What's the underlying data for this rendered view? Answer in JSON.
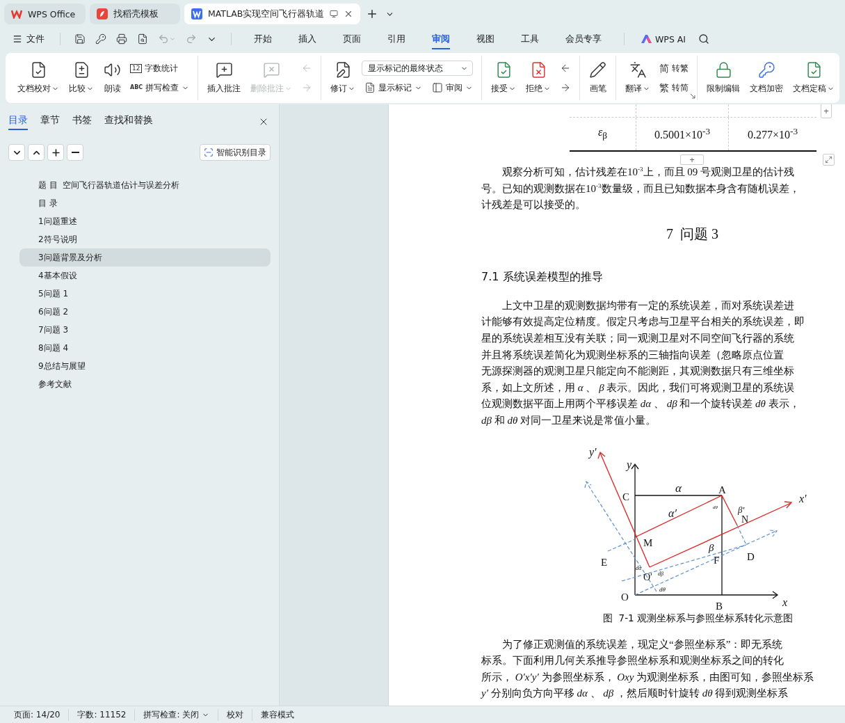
{
  "app_tabs": [
    {
      "kind": "home",
      "label": "WPS Office",
      "selected": false
    },
    {
      "kind": "template",
      "label": "找稻壳模板",
      "selected": false
    },
    {
      "kind": "doc",
      "label": "MATLAB实现空间飞行器轨道",
      "selected": true
    }
  ],
  "menu": {
    "file": "文件",
    "tabs": [
      {
        "label": "开始",
        "selected": false
      },
      {
        "label": "插入",
        "selected": false
      },
      {
        "label": "页面",
        "selected": false
      },
      {
        "label": "引用",
        "selected": false
      },
      {
        "label": "审阅",
        "selected": true
      },
      {
        "label": "视图",
        "selected": false
      },
      {
        "label": "工具",
        "selected": false
      },
      {
        "label": "会员专享",
        "selected": false
      }
    ],
    "ai": "WPS AI"
  },
  "ribbon": {
    "groups": [
      {
        "cols": [
          [
            {
              "kind": "big",
              "label": "文档校对",
              "dropdown": true,
              "disabled": false
            }
          ],
          [
            {
              "kind": "big",
              "label": "比较",
              "dropdown": true,
              "disabled": false
            }
          ],
          [
            {
              "kind": "big",
              "label": "朗读",
              "dropdown": false,
              "disabled": false
            }
          ],
          [
            {
              "kind": "small",
              "glyph": "12",
              "label": "字数统计",
              "dropdown": false,
              "disabled": false
            },
            {
              "kind": "small",
              "glyph": "ABC",
              "label": "拼写检查",
              "dropdown": true,
              "disabled": false
            }
          ]
        ]
      },
      {
        "cols": [
          [
            {
              "kind": "big",
              "label": "插入批注",
              "dropdown": false,
              "disabled": false
            }
          ],
          [
            {
              "kind": "big",
              "label": "删除批注",
              "dropdown": true,
              "disabled": true
            }
          ],
          [
            {
              "kind": "icon",
              "disabled": true
            },
            {
              "kind": "icon",
              "disabled": true
            }
          ]
        ]
      },
      {
        "cols": [
          [
            {
              "kind": "big",
              "label": "修订",
              "dropdown": true,
              "disabled": false
            }
          ],
          [
            {
              "kind": "select",
              "value": "显示标记的最终状态"
            },
            {
              "kind": "row",
              "items": [
                {
                  "kind": "small",
                  "label": "显示标记",
                  "dropdown": true,
                  "disabled": false
                },
                {
                  "kind": "small",
                  "label": "审阅",
                  "dropdown": true,
                  "disabled": false
                }
              ]
            }
          ]
        ]
      },
      {
        "cols": [
          [
            {
              "kind": "big",
              "label": "接受",
              "dropdown": true,
              "disabled": false
            }
          ],
          [
            {
              "kind": "big",
              "label": "拒绝",
              "dropdown": true,
              "disabled": false
            }
          ],
          [
            {
              "kind": "icon",
              "disabled": false
            },
            {
              "kind": "icon",
              "disabled": false
            }
          ]
        ]
      },
      {
        "cols": [
          [
            {
              "kind": "big",
              "label": "画笔",
              "dropdown": false,
              "disabled": false
            }
          ]
        ]
      },
      {
        "cols": [
          [
            {
              "kind": "big",
              "label": "翻译",
              "dropdown": true,
              "disabled": false
            }
          ],
          [
            {
              "kind": "small",
              "glyph": "简",
              "label": "转繁",
              "dropdown": false,
              "disabled": false
            },
            {
              "kind": "small",
              "glyph": "繁",
              "label": "转简",
              "dropdown": false,
              "disabled": false
            }
          ]
        ]
      },
      {
        "cols": [
          [
            {
              "kind": "big",
              "label": "限制编辑",
              "dropdown": false,
              "disabled": false
            }
          ],
          [
            {
              "kind": "big",
              "label": "文档加密",
              "dropdown": false,
              "disabled": false
            }
          ],
          [
            {
              "kind": "big",
              "label": "文档定稿",
              "dropdown": true,
              "disabled": false
            }
          ]
        ]
      }
    ]
  },
  "nav": {
    "tabs": [
      {
        "label": "目录",
        "selected": true
      },
      {
        "label": "章节",
        "selected": false
      },
      {
        "label": "书签",
        "selected": false
      },
      {
        "label": "查找和替换",
        "selected": false
      }
    ],
    "smart_button": "智能识别目录",
    "toc": [
      {
        "label": "题 目  空间飞行器轨道估计与误差分析",
        "selected": false
      },
      {
        "label": "目 录",
        "selected": false
      },
      {
        "label": "1问题重述",
        "selected": false
      },
      {
        "label": "2符号说明",
        "selected": false
      },
      {
        "label": "3问题背景及分析",
        "selected": true
      },
      {
        "label": "4基本假设",
        "selected": false
      },
      {
        "label": "5问题 1",
        "selected": false
      },
      {
        "label": "6问题 2",
        "selected": false
      },
      {
        "label": "7问题 3",
        "selected": false
      },
      {
        "label": "8问题 4",
        "selected": false
      },
      {
        "label": "9总结与展望",
        "selected": false
      },
      {
        "label": "参考文献",
        "selected": false
      }
    ]
  },
  "document": [
    {
      "kind": "table",
      "rows": [
        [
          "*ε*$_{β}$",
          "0.5001×10$^{-3}$",
          "0.277×10$^{-3}$"
        ]
      ],
      "add_column": "+",
      "add_row": "+"
    },
    {
      "kind": "para",
      "indent": true,
      "lines": [
        "观察分析可知，估计残差在10$^{-3}$上，而且 09 号观测卫星的估计残",
        "号。已知的观测数据在10$^{-3}$数量级，而且已知数据本身含有随机误差，",
        "计残差是可以接受的。"
      ]
    },
    {
      "kind": "heading",
      "text": "7  问题 3"
    },
    {
      "kind": "subheading",
      "text": "7.1 系统误差模型的推导"
    },
    {
      "kind": "para",
      "indent": true,
      "lines": [
        "上文中卫星的观测数据均带有一定的系统误差，而对系统误差进",
        "计能够有效提高定位精度。假定只考虑与卫星平台相关的系统误差，即",
        "星的系统误差相互没有关联；同一观测卫星对不同空间飞行器的系统",
        "并且将系统误差简化为观测坐标系的三轴指向误差（忽略原点位置",
        "无源探测器的观测卫星只能定向不能测距，其观测数据只有三维坐标",
        "系，如上文所述，用 *α* 、 *β* 表示。因此，我们可将观测卫星的系统误",
        "位观测数据平面上用两个平移误差 *dα* 、 *dβ* 和一个旋转误差 *dθ* 表示，",
        "*dβ* 和 *dθ* 对同一卫星来说是常值小量。"
      ]
    },
    {
      "kind": "figure",
      "labels": [
        "y′",
        "y",
        "C",
        "α",
        "A",
        "x′",
        "dθ",
        "β′",
        "N",
        "α′",
        "M",
        "β",
        "D",
        "E",
        "F",
        "dα",
        "O′",
        "dβ",
        "O",
        "dθ",
        "B",
        "x"
      ],
      "caption": "图  7-1 观测坐标系与参照坐标系转化示意图"
    },
    {
      "kind": "para",
      "indent": true,
      "lines": [
        "为了修正观测值的系统误差，现定义“参照坐标系”：即无系统",
        "标系。下面利用几何关系推导参照坐标系和观测坐标系之间的转化",
        "所示， *O′x′y′* 为参照坐标系， *Oxy* 为观测坐标系，由图可知，参照坐标系",
        "*y′* 分别向负方向平移 *dα* 、 *dβ* ，然后顺时针旋转 *dθ* 得到观测坐标系"
      ]
    }
  ],
  "status_bar": [
    {
      "label": "页面: 14/20",
      "dropdown": false
    },
    {
      "label": "字数: 11152",
      "dropdown": false
    },
    {
      "label": "拼写检查: 关闭",
      "dropdown": true
    },
    {
      "label": "校对",
      "dropdown": false
    },
    {
      "label": "兼容模式",
      "dropdown": false
    }
  ]
}
